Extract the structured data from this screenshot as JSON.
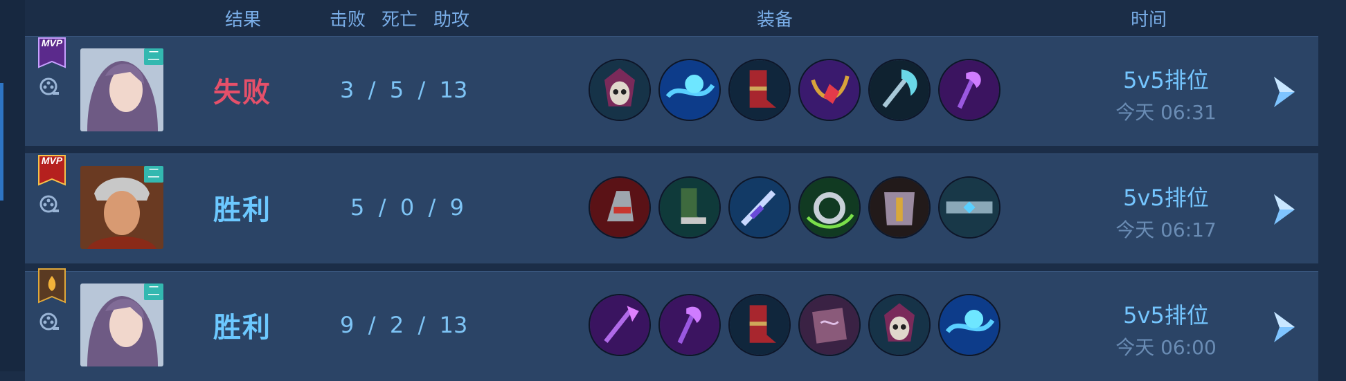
{
  "header": {
    "result": "结果",
    "kills": "击败",
    "deaths": "死亡",
    "assists": "助攻",
    "equipment": "装备",
    "time": "时间"
  },
  "avatar_tag": "二",
  "matches": [
    {
      "badge": "MVP",
      "badge_color": "#5b2a8c",
      "result": "失败",
      "result_type": "lose",
      "kda": "3  /  5  /  13",
      "mode": "5v5排位",
      "time": "今天 06:31",
      "items": [
        "skull-helmet",
        "blue-orb-charm",
        "red-boots",
        "ruby-necklace",
        "ice-axe",
        "purple-staff"
      ]
    },
    {
      "badge": "MVP",
      "badge_color": "#b5201e",
      "result": "胜利",
      "result_type": "win",
      "kda": "5  /  0  /  9",
      "mode": "5v5排位",
      "time": "今天 06:17",
      "items": [
        "red-gauntlet",
        "green-boots",
        "blue-sword",
        "green-ring",
        "gold-armor",
        "jeweled-belt"
      ]
    },
    {
      "badge": "",
      "badge_color": "#c88a22",
      "result": "胜利",
      "result_type": "win",
      "kda": "9  /  2  /  13",
      "mode": "5v5排位",
      "time": "今天 06:00",
      "items": [
        "purple-scepter",
        "purple-staff",
        "red-boots",
        "spell-book",
        "skull-helmet",
        "blue-orb-charm"
      ]
    }
  ]
}
